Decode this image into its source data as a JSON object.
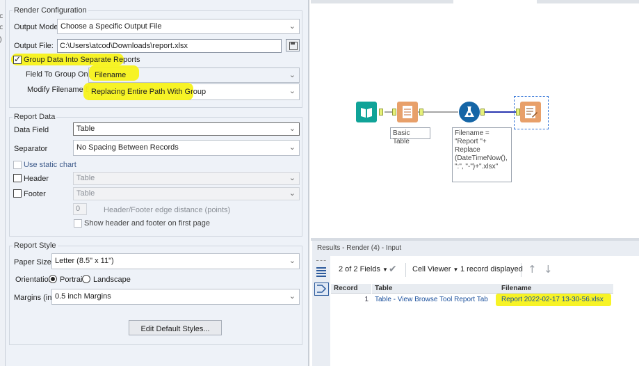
{
  "left_strip": {
    "glyphs": [
      "c",
      "c",
      ")"
    ]
  },
  "render_config": {
    "title": "Render Configuration",
    "output_mode_label": "Output Mode:",
    "output_mode_value": "Choose a Specific Output File",
    "output_file_label": "Output File:",
    "output_file_value": "C:\\Users\\atcod\\Downloads\\report.xlsx",
    "group_data_label": "Group Data Into Separate Reports",
    "group_data_checked": true,
    "field_to_group_label": "Field To Group On:",
    "field_to_group_value": "Filename",
    "modify_filename_label": "Modify Filename By:",
    "modify_filename_value": "Replacing Entire Path With Group"
  },
  "report_data": {
    "title": "Report Data",
    "data_field_label": "Data Field",
    "data_field_value": "Table",
    "separator_label": "Separator",
    "separator_value": "No Spacing Between Records",
    "static_chart_label": "Use static chart",
    "header_label": "Header",
    "header_value": "Table",
    "footer_label": "Footer",
    "footer_value": "Table",
    "edge_distance_value": "0",
    "edge_distance_label": "Header/Footer edge distance (points)",
    "show_first_page_label": "Show header and footer on first page"
  },
  "report_style": {
    "title": "Report Style",
    "paper_size_label": "Paper Size",
    "paper_size_value": "Letter (8.5\" x 11\")",
    "orientation_label": "Orientation",
    "portrait_label": "Portrait",
    "landscape_label": "Landscape",
    "orientation_selected": "Portrait",
    "margins_label": "Margins (in.)",
    "margins_value": "0.5 inch Margins",
    "edit_styles_button": "Edit Default Styles..."
  },
  "canvas": {
    "basic_table_annotation": "Basic Table",
    "formula_annotation": [
      "Filename =",
      "\"Report \"+",
      "Replace",
      "(DateTimeNow(),",
      "\":\", \"-\")+\".xlsx\""
    ]
  },
  "results": {
    "title": "Results - Render (4) - Input",
    "fields_label": "2 of 2 Fields",
    "viewer_label": "Cell Viewer",
    "records_label": "1 record displayed",
    "columns": [
      "Record",
      "Table",
      "Filename"
    ],
    "rows": [
      {
        "record": "1",
        "table": "Table - View Browse Tool Report Tab",
        "filename": "Report 2022-02-17 13-30-56.xlsx"
      }
    ]
  },
  "colors": {
    "highlight": "#f7f21a",
    "link": "#1a4f9c",
    "panel_bg": "#eef2f8"
  },
  "icons": [
    "save-icon",
    "chevron-down-icon",
    "input-book-icon",
    "basic-table-icon",
    "formula-flask-icon",
    "render-report-icon",
    "check-icon",
    "arrow-up-icon",
    "arrow-down-icon",
    "grid-list-icon"
  ]
}
